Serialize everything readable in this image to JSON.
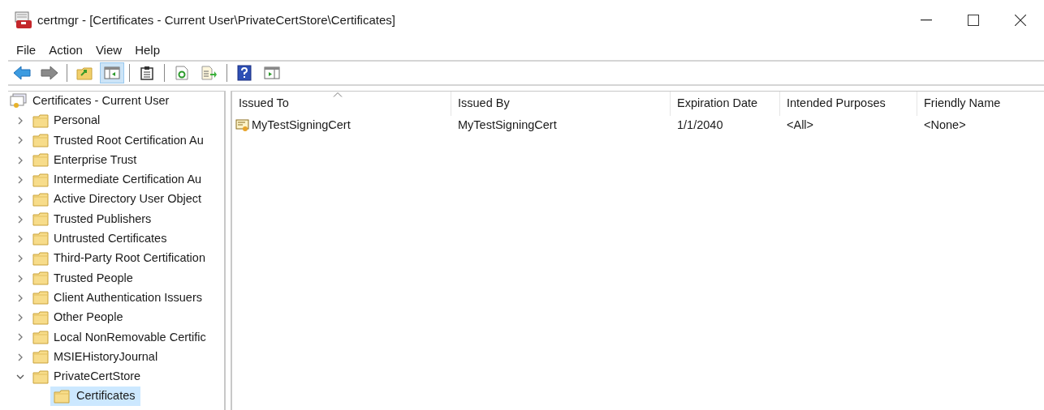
{
  "window": {
    "title": "certmgr - [Certificates - Current User\\PrivateCertStore\\Certificates]"
  },
  "menu": [
    "File",
    "Action",
    "View",
    "Help"
  ],
  "toolbar": [
    {
      "kind": "back",
      "selected": false
    },
    {
      "kind": "forward",
      "selected": false
    },
    {
      "kind": "separator"
    },
    {
      "kind": "up",
      "selected": false
    },
    {
      "kind": "tree",
      "selected": true
    },
    {
      "kind": "separator"
    },
    {
      "kind": "clipboard",
      "selected": false
    },
    {
      "kind": "separator"
    },
    {
      "kind": "refresh",
      "selected": false
    },
    {
      "kind": "export",
      "selected": false
    },
    {
      "kind": "separator"
    },
    {
      "kind": "help",
      "selected": false
    },
    {
      "kind": "actionpane",
      "selected": false
    }
  ],
  "tree": {
    "label": "Certificates - Current User",
    "children": [
      {
        "label": "Personal",
        "expanded": false,
        "selected": false
      },
      {
        "label": "Trusted Root Certification Au",
        "expanded": false,
        "selected": false
      },
      {
        "label": "Enterprise Trust",
        "expanded": false,
        "selected": false
      },
      {
        "label": "Intermediate Certification Au",
        "expanded": false,
        "selected": false
      },
      {
        "label": "Active Directory User Object",
        "expanded": false,
        "selected": false
      },
      {
        "label": "Trusted Publishers",
        "expanded": false,
        "selected": false
      },
      {
        "label": "Untrusted Certificates",
        "expanded": false,
        "selected": false
      },
      {
        "label": "Third-Party Root Certification",
        "expanded": false,
        "selected": false
      },
      {
        "label": "Trusted People",
        "expanded": false,
        "selected": false
      },
      {
        "label": "Client Authentication Issuers",
        "expanded": false,
        "selected": false
      },
      {
        "label": "Other People",
        "expanded": false,
        "selected": false
      },
      {
        "label": "Local NonRemovable Certific",
        "expanded": false,
        "selected": false
      },
      {
        "label": "MSIEHistoryJournal",
        "expanded": false,
        "selected": false
      },
      {
        "label": "PrivateCertStore",
        "expanded": true,
        "selected": false,
        "children": [
          {
            "label": "Certificates",
            "selected": true
          }
        ]
      }
    ]
  },
  "table": {
    "columns": [
      {
        "label": "Issued To",
        "sorted": true
      },
      {
        "label": "Issued By",
        "sorted": false
      },
      {
        "label": "Expiration Date",
        "sorted": false
      },
      {
        "label": "Intended Purposes",
        "sorted": false
      },
      {
        "label": "Friendly Name",
        "sorted": false
      }
    ],
    "rows": [
      [
        "MyTestSigningCert",
        "MyTestSigningCert",
        "1/1/2040",
        "<All>",
        "<None>"
      ]
    ]
  }
}
